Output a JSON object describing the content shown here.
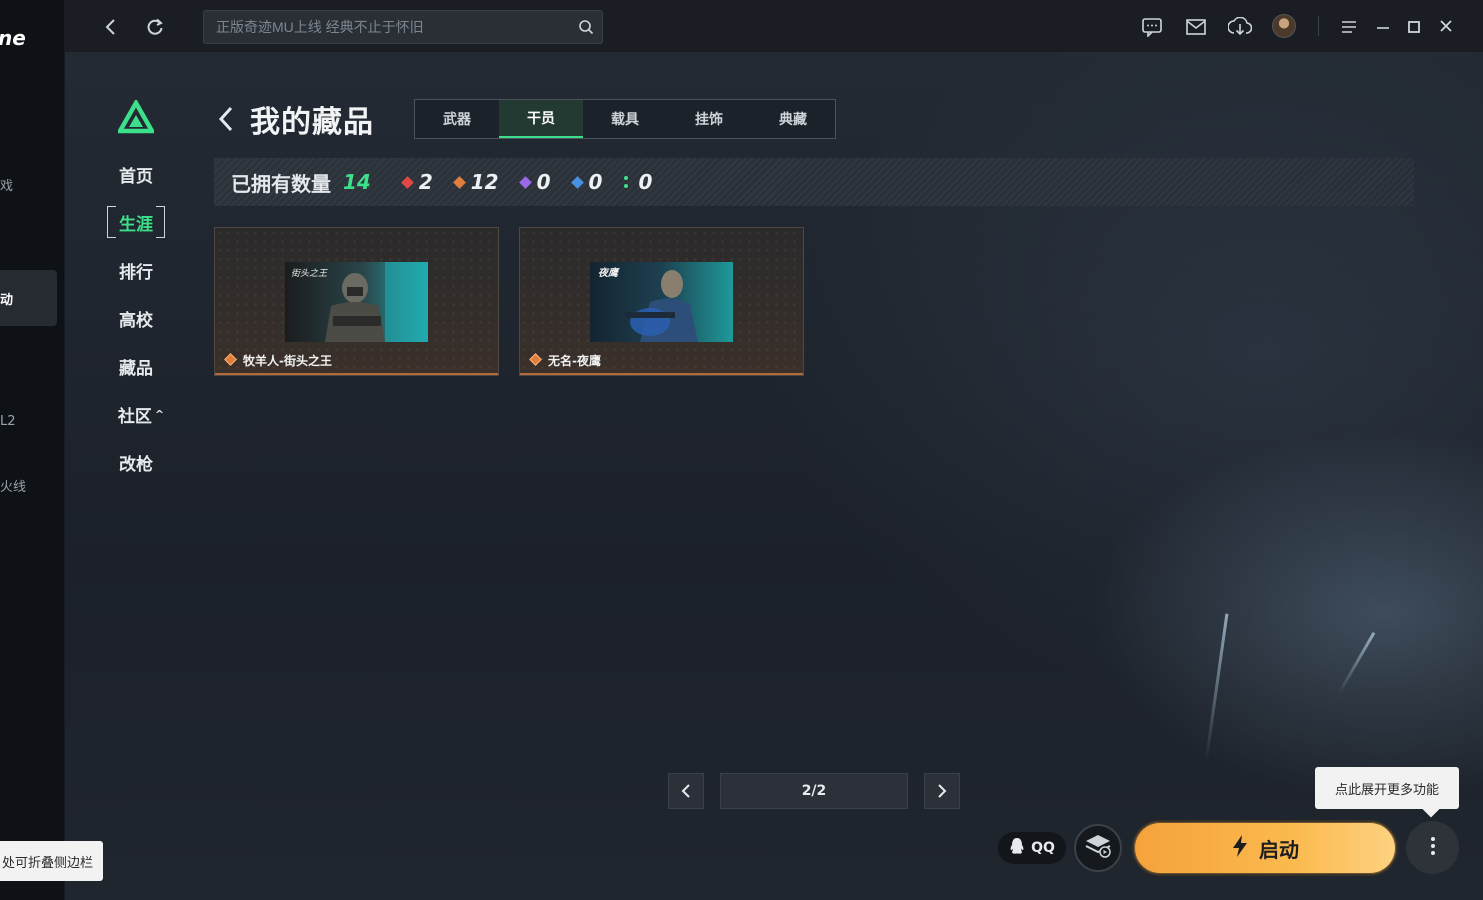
{
  "outer_sidebar": {
    "logo_fragment": "ne",
    "fragments": [
      "戏",
      "动",
      "L2",
      "火线"
    ]
  },
  "topbar": {
    "search_placeholder": "正版奇迹MU上线 经典不止于怀旧",
    "icons": [
      "back-icon",
      "refresh-icon",
      "search-icon",
      "message-icon",
      "mail-icon",
      "download-icon",
      "avatar",
      "menu-icon",
      "minimize-icon",
      "maximize-icon",
      "close-icon"
    ]
  },
  "nav": {
    "brand_color": "#3de08a",
    "items": [
      {
        "label": "首页"
      },
      {
        "label": "生涯",
        "active": true
      },
      {
        "label": "排行"
      },
      {
        "label": "高校"
      },
      {
        "label": "藏品"
      },
      {
        "label": "社区",
        "caret": "^"
      },
      {
        "label": "改枪"
      }
    ]
  },
  "page": {
    "title": "我的藏品",
    "tabs": [
      {
        "label": "武器"
      },
      {
        "label": "干员",
        "active": true
      },
      {
        "label": "载具"
      },
      {
        "label": "挂饰"
      },
      {
        "label": "典藏"
      }
    ]
  },
  "summary": {
    "label": "已拥有数量",
    "total": "14",
    "rarities": [
      {
        "color": "#e04848",
        "count": "2"
      },
      {
        "color": "#e07e3d",
        "count": "12"
      },
      {
        "color": "#9a6ae6",
        "count": "0"
      },
      {
        "color": "#4a90e2",
        "count": "0"
      },
      {
        "color": "#3de08a",
        "count": "0"
      }
    ]
  },
  "cards": [
    {
      "name": "牧羊人-街头之王",
      "rarity_color": "#e07e3d"
    },
    {
      "name": "无名-夜鹰",
      "rarity_color": "#e07e3d"
    }
  ],
  "pager": {
    "current": "2/2"
  },
  "bottom": {
    "tooltip": "点此展开更多功能",
    "qq_label": "QQ",
    "launch_label": "启动",
    "fold_tip": "处可折叠侧边栏"
  },
  "colors": {
    "accent_green": "#3de08a",
    "launch_orange": "#f5a23b"
  }
}
